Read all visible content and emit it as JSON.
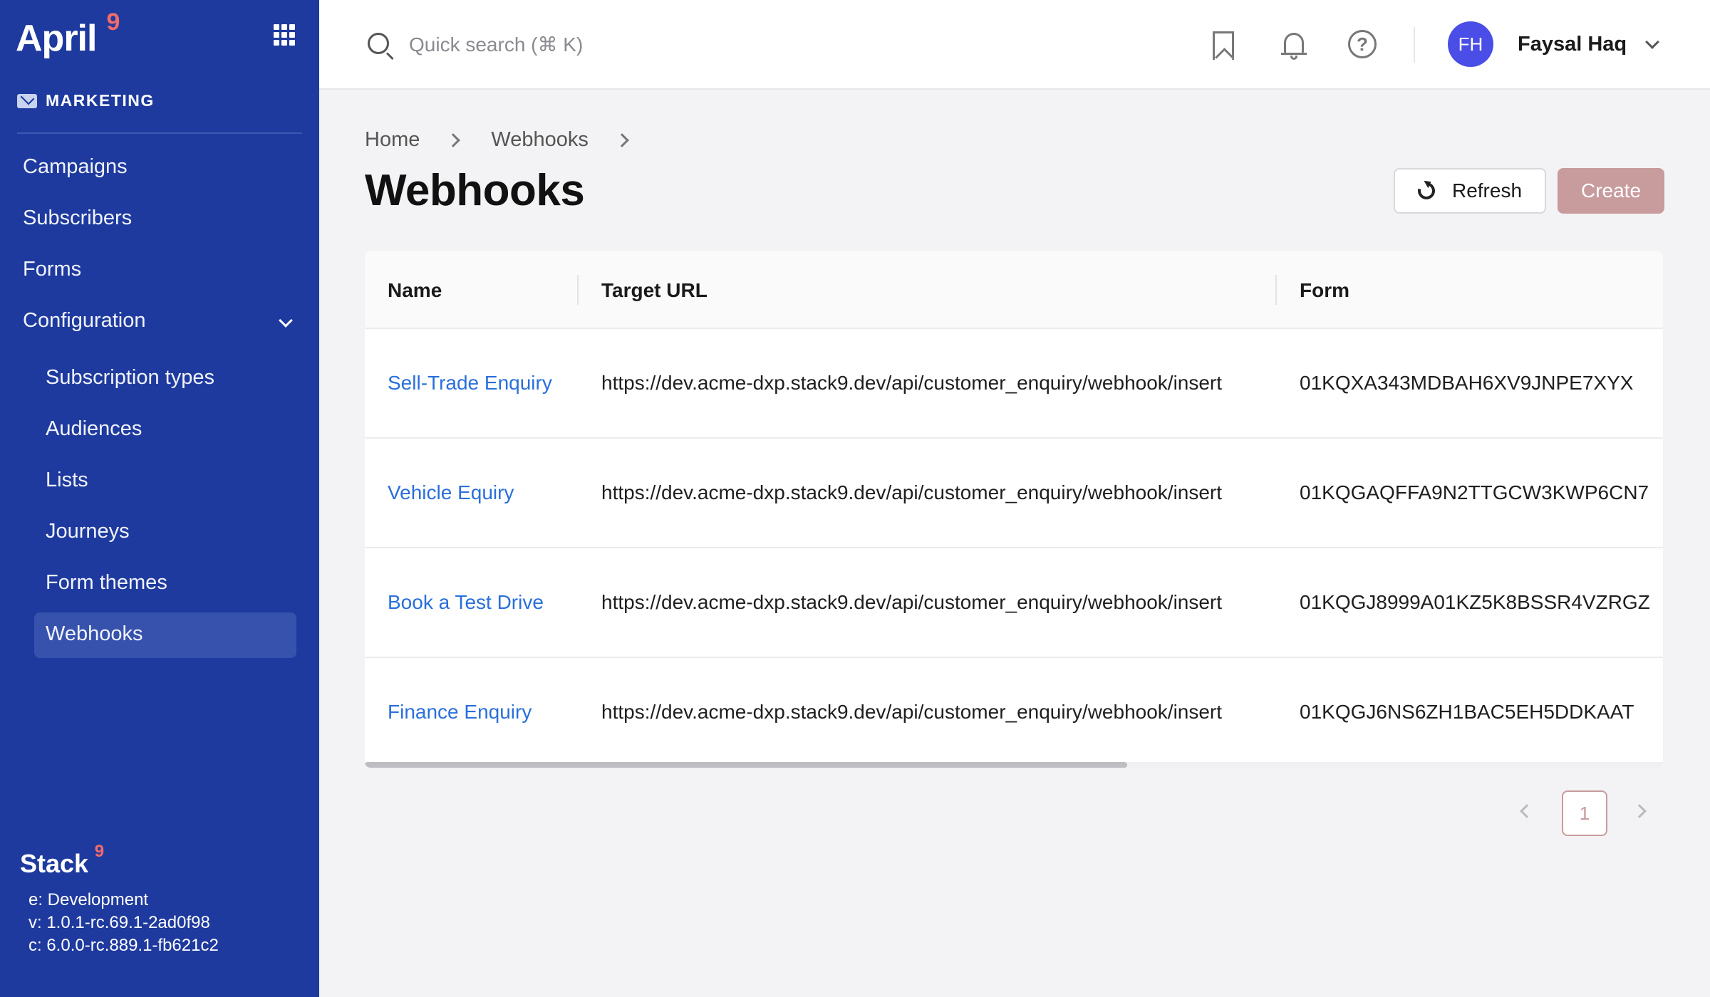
{
  "app": {
    "brand": "April",
    "brand_superscript": "9"
  },
  "sidebar": {
    "section": "MARKETING",
    "items": [
      {
        "label": "Campaigns"
      },
      {
        "label": "Subscribers"
      },
      {
        "label": "Forms"
      },
      {
        "label": "Configuration"
      }
    ],
    "sub_items": [
      {
        "label": "Subscription types"
      },
      {
        "label": "Audiences"
      },
      {
        "label": "Lists"
      },
      {
        "label": "Journeys"
      },
      {
        "label": "Form themes"
      },
      {
        "label": "Webhooks"
      }
    ],
    "footer": {
      "brand": "Stack",
      "brand_superscript": "9",
      "env": "e: Development",
      "version": "v: 1.0.1-rc.69.1-2ad0f98",
      "core": "c: 6.0.0-rc.889.1-fb621c2"
    }
  },
  "header": {
    "search_placeholder": "Quick search (⌘ K)",
    "user": {
      "initials": "FH",
      "name": "Faysal Haq"
    },
    "colors": {
      "avatar": "#4a4de6"
    }
  },
  "breadcrumb": [
    "Home",
    "Webhooks"
  ],
  "page": {
    "title": "Webhooks",
    "refresh_label": "Refresh",
    "create_label": "Create"
  },
  "table": {
    "columns": [
      "Name",
      "Target URL",
      "Form"
    ],
    "rows": [
      {
        "name": "Sell-Trade Enquiry",
        "url": "https://dev.acme-dxp.stack9.dev/api/customer_enquiry/webhook/insert",
        "form": "01KQXA343MDBAH6XV9JNPE7XYX"
      },
      {
        "name": "Vehicle Equiry",
        "url": "https://dev.acme-dxp.stack9.dev/api/customer_enquiry/webhook/insert",
        "form": "01KQGAQFFA9N2TTGCW3KWP6CN7"
      },
      {
        "name": "Book a Test Drive",
        "url": "https://dev.acme-dxp.stack9.dev/api/customer_enquiry/webhook/insert",
        "form": "01KQGJ8999A01KZ5K8BSSR4VZRGZ"
      },
      {
        "name": "Finance Enquiry",
        "url": "https://dev.acme-dxp.stack9.dev/api/customer_enquiry/webhook/insert",
        "form": "01KQGJ6NS6ZH1BAC5EH5DDKAAT"
      }
    ]
  },
  "pagination": {
    "current": "1"
  },
  "colors": {
    "sidebar": "#1e3a9e",
    "accent": "#c89b9d",
    "link": "#2a6fdb",
    "brand_nine": "#f26b6b"
  }
}
